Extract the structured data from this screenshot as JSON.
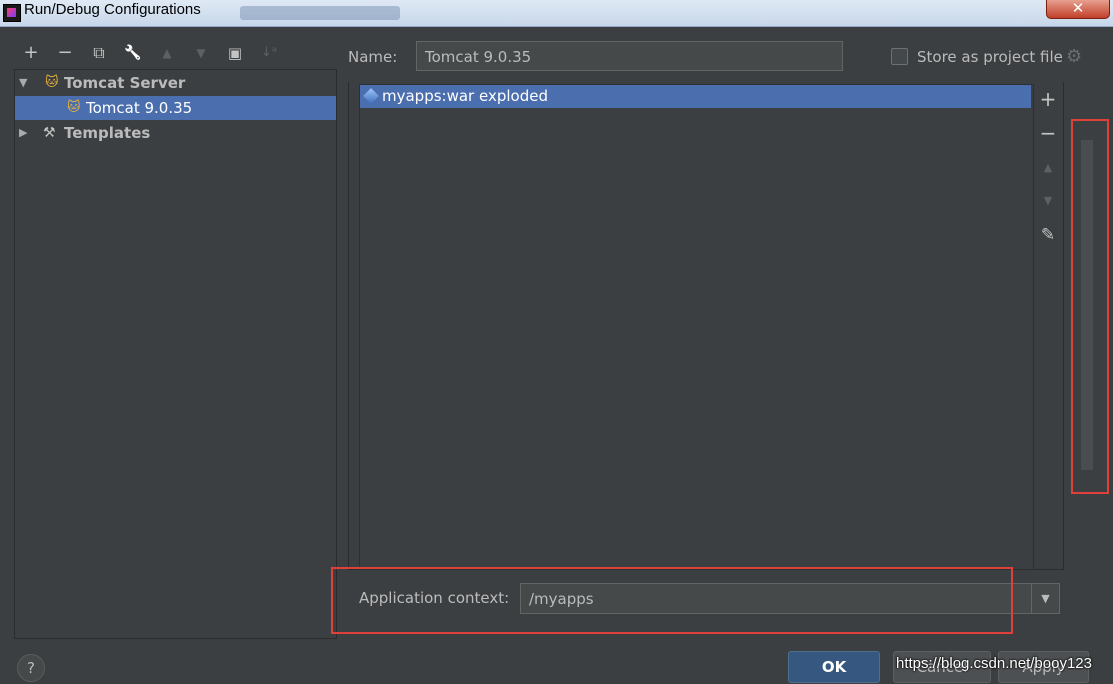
{
  "window": {
    "title": "Run/Debug Configurations",
    "close_glyph": "✕"
  },
  "toolbar": {
    "icons": [
      "add-icon",
      "remove-icon",
      "copy-icon",
      "wrench-icon",
      "move-up-icon",
      "move-down-icon",
      "new-folder-icon",
      "sort-icon"
    ],
    "add_glyph": "+",
    "remove_glyph": "−",
    "copy_glyph": "⧉",
    "wrench_glyph": "🔧",
    "up_glyph": "▲",
    "down_glyph": "▼",
    "folder_glyph": "▣",
    "sort_glyph": "↓ᵃ"
  },
  "tree": {
    "items": [
      {
        "label": "Tomcat Server",
        "expanded": true,
        "icon": "tomcat-icon",
        "arrow": "▼"
      },
      {
        "label": "Tomcat 9.0.35",
        "selected": true,
        "icon": "tomcat-icon"
      },
      {
        "label": "Templates",
        "expanded": false,
        "icon": "wrench-icon",
        "arrow": "▶"
      }
    ]
  },
  "form": {
    "name_label": "Name:",
    "name_value": "Tomcat 9.0.35",
    "store_label": "Store as project file",
    "store_checked": false
  },
  "deployment": {
    "items": [
      {
        "label": "myapps:war exploded",
        "icon": "artifact-icon"
      }
    ],
    "side_glyphs": {
      "add": "+",
      "remove": "−",
      "up": "▲",
      "down": "▼",
      "edit": "✎"
    }
  },
  "context": {
    "label": "Application context:",
    "value": "/myapps",
    "dropdown_glyph": "▼"
  },
  "buttons": {
    "help": "?",
    "ok": "OK",
    "cancel": "Cancel",
    "apply": "Apply"
  },
  "watermark": "https://blog.csdn.net/booy123",
  "colors": {
    "selection": "#4b6eaf",
    "background": "#3c3f41",
    "highlight_box": "#e0403a",
    "ok_button": "#365880"
  }
}
